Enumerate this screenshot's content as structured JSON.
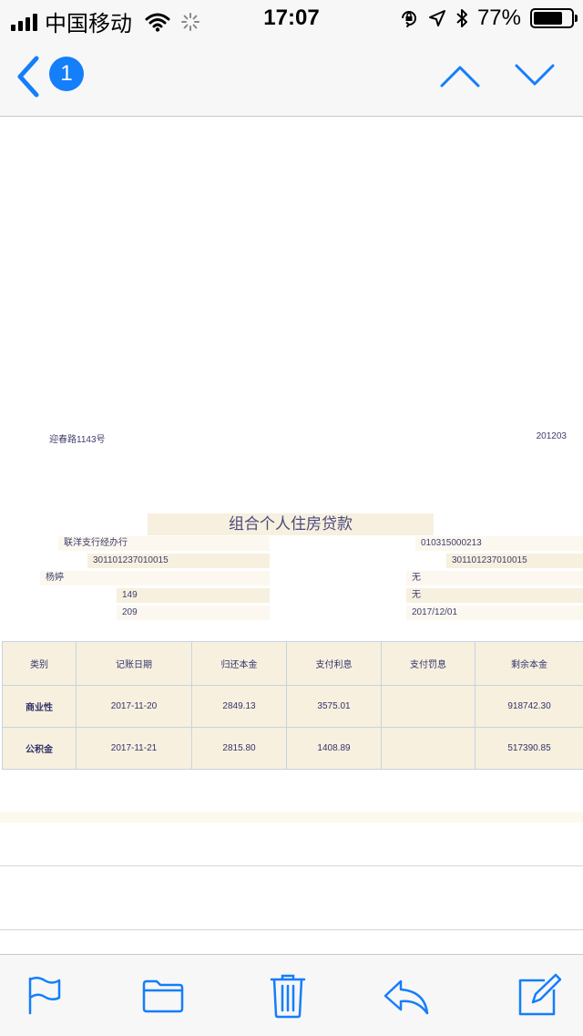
{
  "status_bar": {
    "carrier": "中国移动",
    "time": "17:07",
    "battery_percent": "77%",
    "battery_level": 0.77,
    "icons": [
      "signal-icon",
      "wifi-icon",
      "activity-spinner-icon",
      "orientation-lock-icon",
      "location-icon",
      "bluetooth-icon",
      "battery-icon"
    ]
  },
  "nav": {
    "back_badge": "1",
    "icons": [
      "back-chevron-icon",
      "previous-message-icon",
      "next-message-icon"
    ]
  },
  "statement": {
    "address": "迎春路1143号",
    "period": "201203",
    "title": "组合个人住房贷款",
    "left_fields": [
      "联洋支行经办行",
      "301101237010015",
      "杨婷",
      "149",
      "209"
    ],
    "right_fields": [
      "010315000213",
      "301101237010015",
      "无",
      "无",
      "2017/12/01"
    ],
    "table": {
      "headers": [
        "类别",
        "记账日期",
        "归还本金",
        "支付利息",
        "支付罚息",
        "剩余本金"
      ],
      "rows": [
        [
          "商业性",
          "2017-11-20",
          "2849.13",
          "3575.01",
          "",
          "918742.30"
        ],
        [
          "公积金",
          "2017-11-21",
          "2815.80",
          "1408.89",
          "",
          "517390.85"
        ]
      ]
    }
  },
  "toolbar": {
    "icons": [
      "flag-icon",
      "folder-icon",
      "trash-icon",
      "reply-icon",
      "compose-icon"
    ]
  },
  "colors": {
    "accent": "#147efb",
    "cell_fill": "#f7f0df",
    "text": "#3f3d6e"
  }
}
